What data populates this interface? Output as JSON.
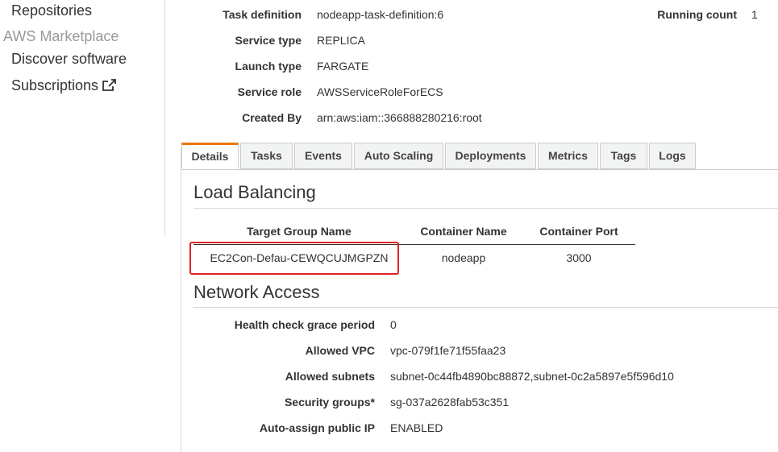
{
  "sidebar": {
    "repositories": "Repositories",
    "marketplace_heading": "AWS Marketplace",
    "discover": "Discover software",
    "subscriptions": "Subscriptions"
  },
  "summary": {
    "task_definition_label": "Task definition",
    "task_definition_value": "nodeapp-task-definition:6",
    "service_type_label": "Service type",
    "service_type_value": "REPLICA",
    "launch_type_label": "Launch type",
    "launch_type_value": "FARGATE",
    "service_role_label": "Service role",
    "service_role_value": "AWSServiceRoleForECS",
    "created_by_label": "Created By",
    "created_by_value": "arn:aws:iam::366888280216:root",
    "running_count_label": "Running count",
    "running_count_value": "1"
  },
  "tabs": [
    "Details",
    "Tasks",
    "Events",
    "Auto Scaling",
    "Deployments",
    "Metrics",
    "Tags",
    "Logs"
  ],
  "load_balancing": {
    "title": "Load Balancing",
    "headers": [
      "Target Group Name",
      "Container Name",
      "Container Port"
    ],
    "row": [
      "EC2Con-Defau-CEWQCUJMGPZN",
      "nodeapp",
      "3000"
    ]
  },
  "network": {
    "title": "Network Access",
    "health_label": "Health check grace period",
    "health_value": "0",
    "vpc_label": "Allowed VPC",
    "vpc_value": "vpc-079f1fe71f55faa23",
    "subnets_label": "Allowed subnets",
    "subnets_value": "subnet-0c44fb4890bc88872,subnet-0c2a5897e5f596d10",
    "sg_label": "Security groups*",
    "sg_value": "sg-037a2628fab53c351",
    "public_ip_label": "Auto-assign public IP",
    "public_ip_value": "ENABLED"
  },
  "colors": {
    "link": "#1e6bb8",
    "tab_accent": "#e77600",
    "highlight": "#e02222"
  }
}
